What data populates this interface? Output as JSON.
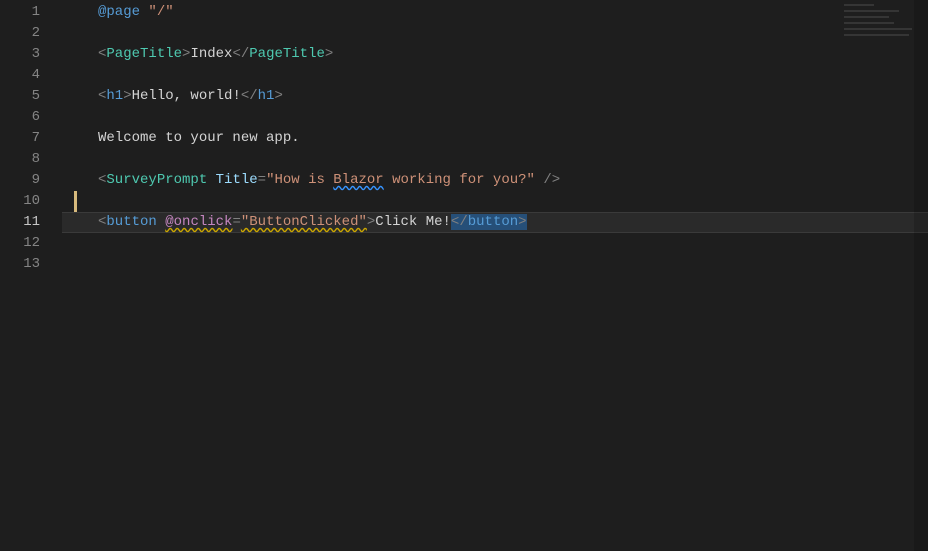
{
  "lineNumbers": [
    "1",
    "2",
    "3",
    "4",
    "5",
    "6",
    "7",
    "8",
    "9",
    "10",
    "11",
    "12",
    "13"
  ],
  "activeLine": 11,
  "changeBar": {
    "startLine": 10,
    "endLine": 11
  },
  "code": {
    "l1": {
      "directive": "@page",
      "path": "\"/\""
    },
    "l3": {
      "open_tag": "PageTitle",
      "text": "Index",
      "close_tag": "PageTitle"
    },
    "l5": {
      "open_tag": "h1",
      "text": "Hello, world!",
      "close_tag": "h1"
    },
    "l7": {
      "text": "Welcome to your new app."
    },
    "l9": {
      "tag": "SurveyPrompt",
      "attr": "Title",
      "value": "\"How is Blazor working for you?\"",
      "blazor_word": "Blazor"
    },
    "l11": {
      "tag": "button",
      "event": "@onclick",
      "handler": "\"ButtonClicked\"",
      "text": "Click Me!",
      "close_tag": "button"
    }
  }
}
